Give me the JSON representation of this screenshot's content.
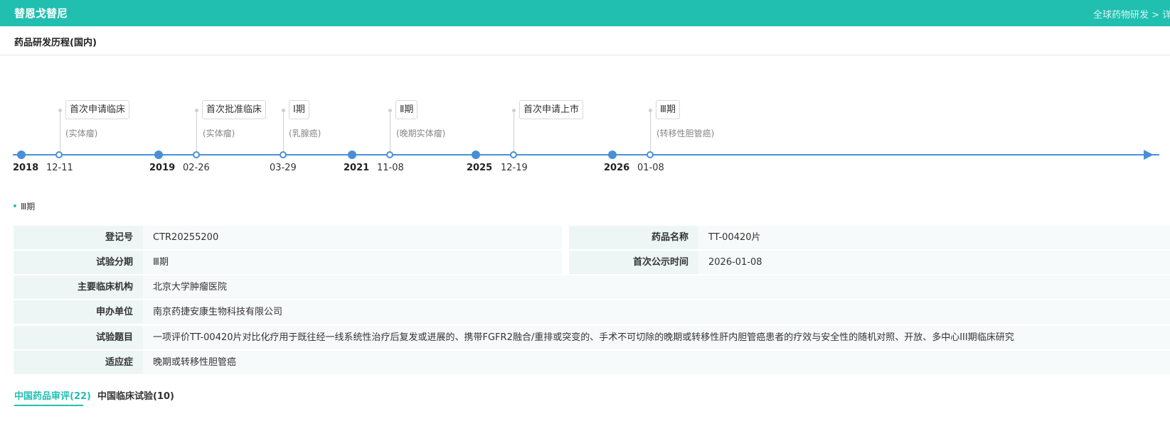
{
  "header": {
    "drug_title": "替恩戈替尼",
    "right_link": "全球药物研发 > 详情"
  },
  "section_title": "药品研发历程(国内)",
  "timeline": {
    "years": [
      "2018",
      "2019",
      "2021",
      "2025",
      "2026"
    ],
    "events": [
      {
        "date": "12-11",
        "tag": "首次申请临床",
        "note": "(实体瘤)"
      },
      {
        "date": "02-26",
        "tag": "首次批准临床",
        "note": "(实体瘤)"
      },
      {
        "date": "03-29",
        "tag": "Ⅰ期",
        "note": "(乳腺癌)"
      },
      {
        "date": "11-08",
        "tag": "Ⅱ期",
        "note": "(晚期实体瘤)"
      },
      {
        "date": "12-19",
        "tag": "首次申请上市",
        "note": ""
      },
      {
        "date": "01-08",
        "tag": "Ⅲ期",
        "note": "(转移性胆管癌)"
      }
    ]
  },
  "phase_heading": "Ⅲ期",
  "details": {
    "reg_no": {
      "label": "登记号",
      "value": "CTR20255200"
    },
    "drug_name": {
      "label": "药品名称",
      "value": "TT-00420片"
    },
    "trial_phase": {
      "label": "试验分期",
      "value": "Ⅲ期"
    },
    "first_public": {
      "label": "首次公示时间",
      "value": "2026-01-08"
    },
    "institution": {
      "label": "主要临床机构",
      "value": "北京大学肿瘤医院"
    },
    "sponsor": {
      "label": "申办单位",
      "value": "南京药捷安康生物科技有限公司"
    },
    "title": {
      "label": "试验题目",
      "value": "一项评价TT-00420片对比化疗用于既往经一线系统性治疗后复发或进展的、携带FGFR2融合/重排或突变的、手术不可切除的晚期或转移性肝内胆管癌患者的疗效与安全性的随机对照、开放、多中心III期临床研究"
    },
    "indication": {
      "label": "适应症",
      "value": "晚期或转移性胆管癌"
    }
  },
  "tabs": [
    {
      "label": "中国药品审评(22)"
    },
    {
      "label": "中国临床试验(10)"
    }
  ],
  "colors": {
    "brand": "#20bfb0",
    "axis": "#4a8fd6"
  }
}
